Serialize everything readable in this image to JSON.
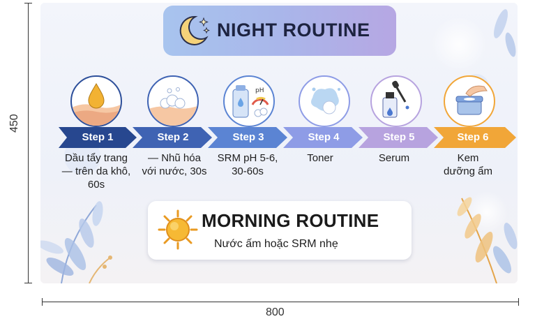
{
  "dimensions": {
    "height_label": "450",
    "width_label": "800"
  },
  "title": {
    "text": "NIGHT ROUTINE",
    "icon": "moon-stars-icon"
  },
  "steps": [
    {
      "label": "Step 1",
      "desc": [
        "Dầu tẩy trang",
        "— trên da khô,",
        "60s"
      ],
      "icon": "oil-drop-skin-icon",
      "color": "#27478f"
    },
    {
      "label": "Step 2",
      "desc": [
        "— Nhũ hóa",
        "với nước, 30s"
      ],
      "icon": "emulsify-foam-icon",
      "color": "#3f63b3"
    },
    {
      "label": "Step 3",
      "desc": [
        "SRM pH 5-6,",
        "30-60s"
      ],
      "icon": "cleanser-tube-ph-icon",
      "color": "#5b84d3"
    },
    {
      "label": "Step 4",
      "desc": [
        "Toner"
      ],
      "icon": "toner-splash-icon",
      "color": "#8e9ce6"
    },
    {
      "label": "Step 5",
      "desc": [
        "Serum"
      ],
      "icon": "serum-dropper-icon",
      "color": "#b7a3df"
    },
    {
      "label": "Step 6",
      "desc": [
        "Kem",
        "dưỡng ẩm"
      ],
      "icon": "moisturizer-jar-icon",
      "color": "#f1a638"
    }
  ],
  "morning": {
    "title": "MORNING ROUTINE",
    "subtitle": "Nước ấm hoặc SRM nhẹ",
    "icon": "sun-icon"
  }
}
